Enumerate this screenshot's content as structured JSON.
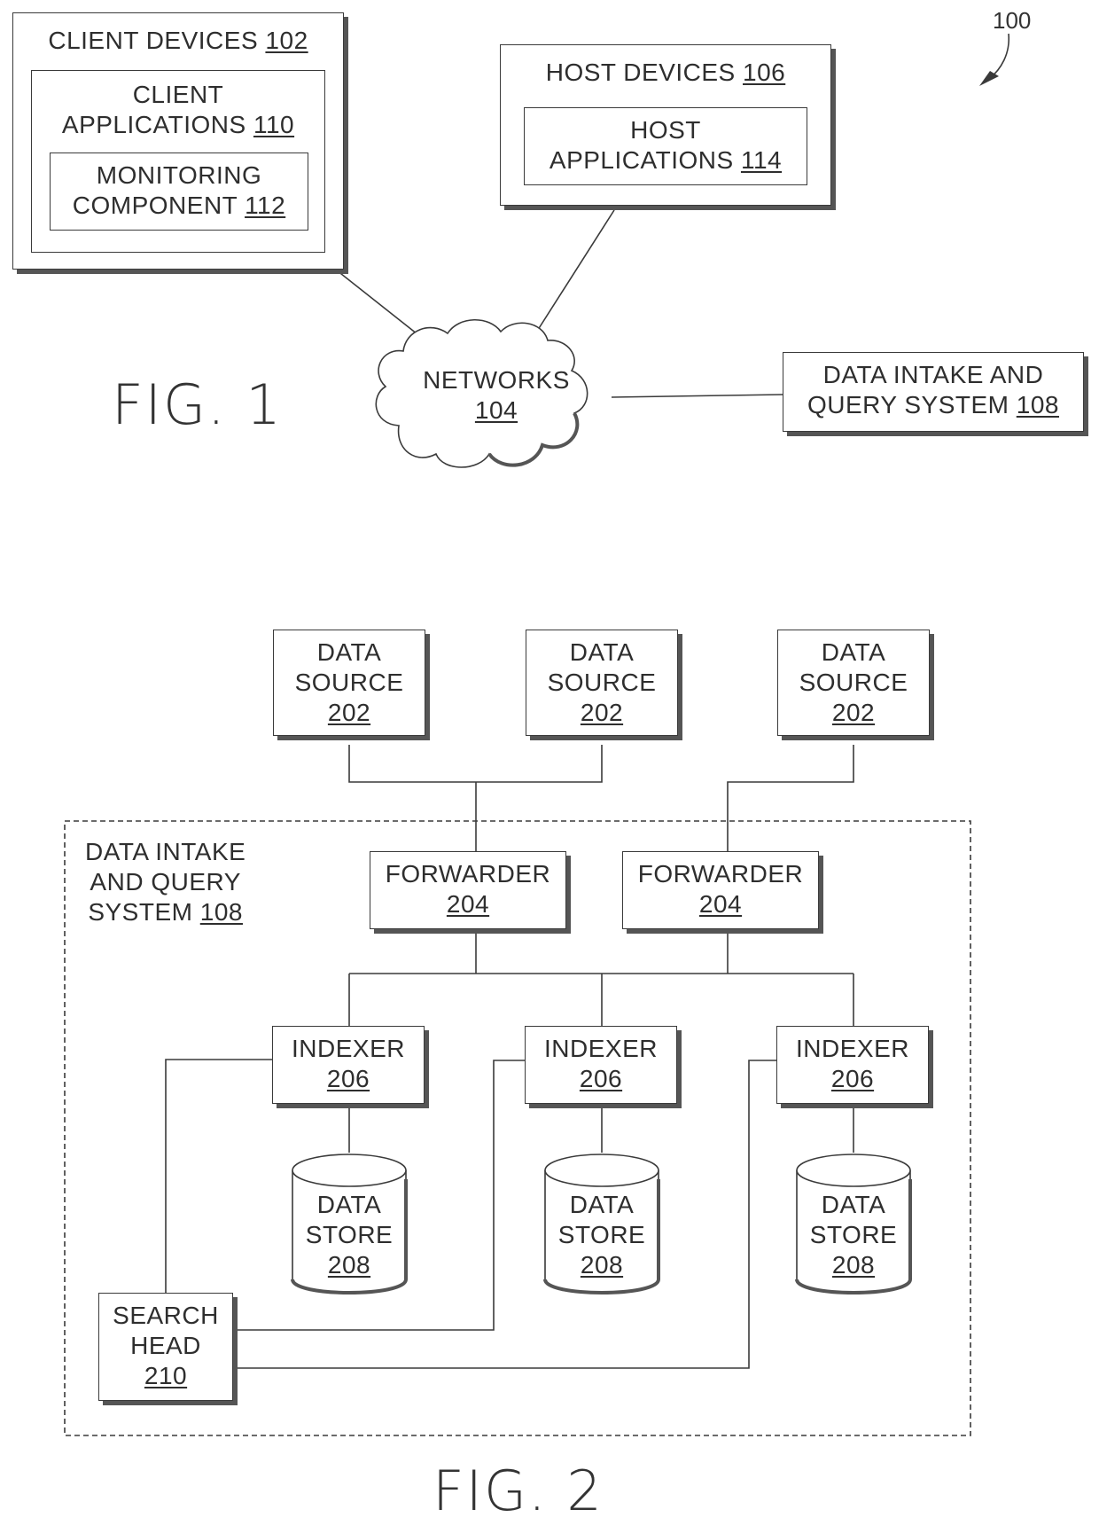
{
  "figure1": {
    "ref_label": "100",
    "caption": "FIG. 1",
    "client_devices": {
      "title": "CLIENT DEVICES",
      "num": "102"
    },
    "client_applications": {
      "line1": "CLIENT",
      "line2": "APPLICATIONS",
      "num": "110"
    },
    "monitoring_component": {
      "line1": "MONITORING",
      "line2": "COMPONENT",
      "num": "112"
    },
    "host_devices": {
      "title": "HOST DEVICES",
      "num": "106"
    },
    "host_applications": {
      "line1": "HOST",
      "line2": "APPLICATIONS",
      "num": "114"
    },
    "networks": {
      "line1": "NETWORKS",
      "num": "104"
    },
    "data_intake": {
      "line1": "DATA INTAKE AND",
      "line2": "QUERY SYSTEM",
      "num": "108"
    }
  },
  "figure2": {
    "caption": "FIG. 2",
    "system_label": {
      "line1": "DATA INTAKE",
      "line2": "AND QUERY",
      "line3": "SYSTEM",
      "num": "108"
    },
    "data_sources": [
      {
        "line1": "DATA",
        "line2": "SOURCE",
        "num": "202"
      },
      {
        "line1": "DATA",
        "line2": "SOURCE",
        "num": "202"
      },
      {
        "line1": "DATA",
        "line2": "SOURCE",
        "num": "202"
      }
    ],
    "forwarders": [
      {
        "line1": "FORWARDER",
        "num": "204"
      },
      {
        "line1": "FORWARDER",
        "num": "204"
      }
    ],
    "indexers": [
      {
        "line1": "INDEXER",
        "num": "206"
      },
      {
        "line1": "INDEXER",
        "num": "206"
      },
      {
        "line1": "INDEXER",
        "num": "206"
      }
    ],
    "data_stores": [
      {
        "line1": "DATA",
        "line2": "STORE",
        "num": "208"
      },
      {
        "line1": "DATA",
        "line2": "STORE",
        "num": "208"
      },
      {
        "line1": "DATA",
        "line2": "STORE",
        "num": "208"
      }
    ],
    "search_head": {
      "line1": "SEARCH",
      "line2": "HEAD",
      "num": "210"
    }
  }
}
